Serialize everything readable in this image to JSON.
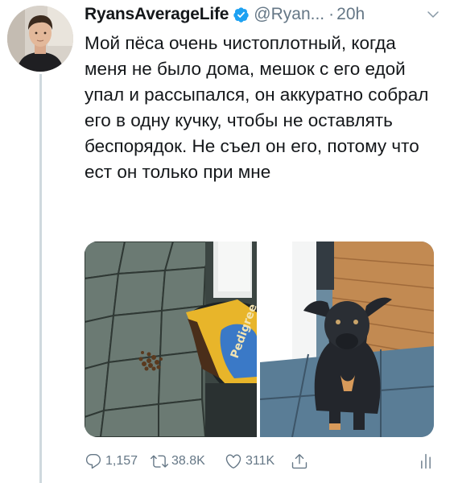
{
  "author": {
    "name": "RyansAverageLife",
    "handle": "@Ryan...",
    "separator": "·",
    "time": "20h"
  },
  "tweet": {
    "text": "Мой пёса очень чистоплотный, когда меня не было дома, мешок с его едой упал и рассыпался, он аккуратно собрал его в одну кучку, чтобы не оставлять беспорядок. Не съел он его, потому что ест он только при мне"
  },
  "media": {
    "bag_brand": "Pedigree"
  },
  "actions": {
    "replies": "1,157",
    "retweets": "38.8K",
    "likes": "311K"
  },
  "colors": {
    "verified": "#1da1f2",
    "muted": "#657786",
    "thread_line": "#cfd9de"
  },
  "icons": [
    "verified-icon",
    "chevron-down-icon",
    "reply-icon",
    "retweet-icon",
    "like-icon",
    "share-icon",
    "analytics-icon"
  ]
}
